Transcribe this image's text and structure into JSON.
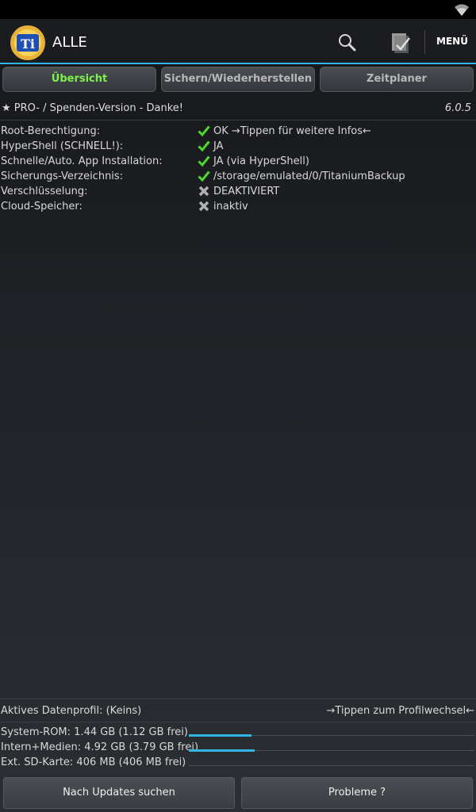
{
  "app": {
    "title": "ALLE",
    "logo_text": "Ti"
  },
  "actionbar": {
    "menu_label": "MENÜ"
  },
  "tabs": [
    {
      "label": "Übersicht",
      "active": true
    },
    {
      "label": "Sichern/Wiederherstellen",
      "active": false
    },
    {
      "label": "Zeitplaner",
      "active": false
    }
  ],
  "pro": {
    "text": "★ PRO- / Spenden-Version - Danke!",
    "version": "6.0.5"
  },
  "info": [
    {
      "label": "Root-Berechtigung:",
      "status": "ok",
      "value": "OK →Tippen für weitere Infos←"
    },
    {
      "label": "HyperShell (SCHNELL!):",
      "status": "ok",
      "value": "JA"
    },
    {
      "label": "Schnelle/Auto. App Installation:",
      "status": "ok",
      "value": "JA (via HyperShell)"
    },
    {
      "label": "Sicherungs-Verzeichnis:",
      "status": "ok",
      "value": "/storage/emulated/0/TitaniumBackup"
    },
    {
      "label": "Verschlüsselung:",
      "status": "off",
      "value": "DEAKTIVIERT"
    },
    {
      "label": "Cloud-Speicher:",
      "status": "off",
      "value": "inaktiv"
    }
  ],
  "profile": {
    "label": "Aktives Datenprofil:   (Keins)",
    "hint": "→Tippen zum Profilwechsel←"
  },
  "storage": [
    {
      "label": "System-ROM:   1.44 GB (1.12 GB frei)",
      "used_fraction": 0.22
    },
    {
      "label": "Intern+Medien: 4.92 GB (3.79 GB frei)",
      "used_fraction": 0.23
    },
    {
      "label": "Ext. SD-Karte:   406 MB (406 MB frei)",
      "used_fraction": 0.0
    }
  ],
  "buttons": {
    "updates": "Nach Updates suchen",
    "problems": "Probleme ?"
  },
  "colors": {
    "accent": "#33b5e5",
    "ok": "#4fd832",
    "off": "#b0b0b0",
    "active_tab": "#7df14a"
  }
}
